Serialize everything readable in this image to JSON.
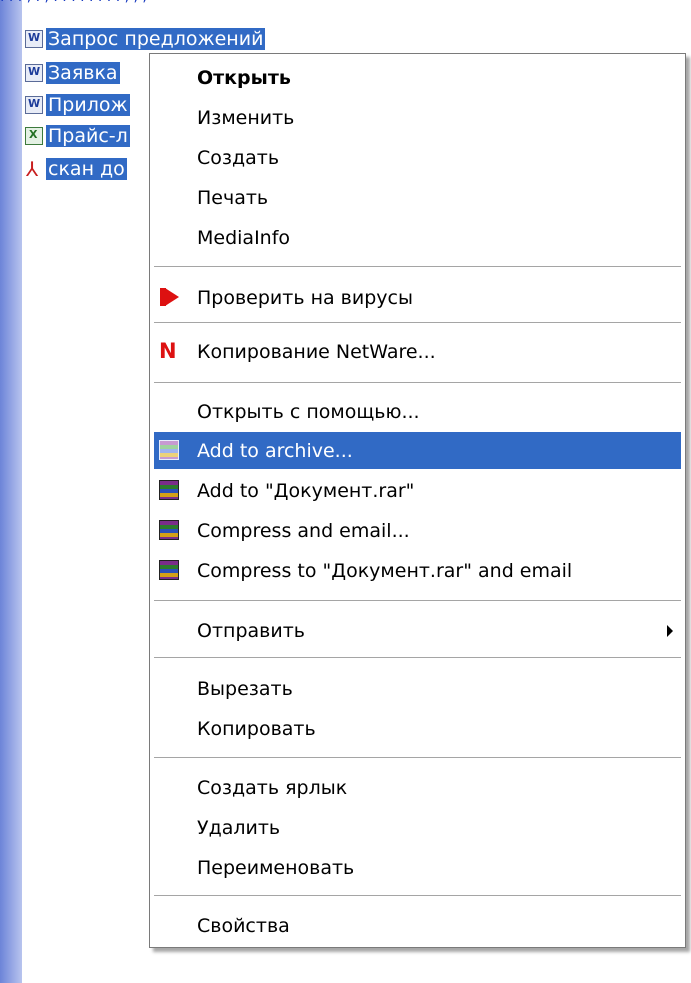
{
  "files": [
    {
      "name": "Запрос предложений",
      "icon": "word-doc-icon"
    },
    {
      "name": "Заявка",
      "icon": "word-doc-icon"
    },
    {
      "name": "Прилож",
      "icon": "word-doc-icon"
    },
    {
      "name": "Прайс-л",
      "icon": "excel-doc-icon"
    },
    {
      "name": "скан до",
      "icon": "pdf-doc-icon"
    }
  ],
  "menu": {
    "open": "Открыть",
    "edit": "Изменить",
    "create": "Создать",
    "print": "Печать",
    "mediainfo": "MediaInfo",
    "scan_virus": "Проверить на вирусы",
    "copy_netware": "Копирование NetWare...",
    "open_with": "Открыть с помощью...",
    "add_archive": "Add to archive...",
    "add_to_rar": "Add to \"Документ.rar\"",
    "compress_email": "Compress and email...",
    "compress_to_rar_email": "Compress to \"Документ.rar\" and email",
    "send_to": "Отправить",
    "cut": "Вырезать",
    "copy": "Копировать",
    "create_shortcut": "Создать ярлык",
    "delete": "Удалить",
    "rename": "Переименовать",
    "properties": "Свойства"
  },
  "colors": {
    "selection": "#316ac5",
    "kaspersky": "#dd1111",
    "netware": "#dd1111"
  }
}
